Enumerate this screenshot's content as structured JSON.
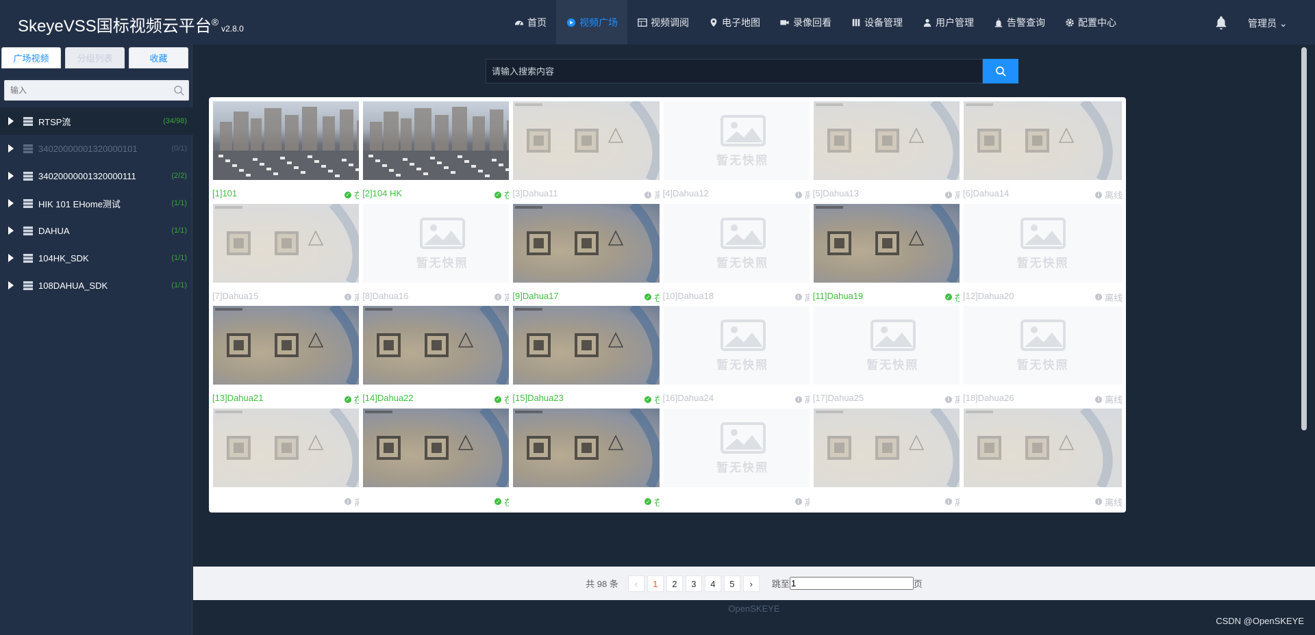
{
  "app": {
    "title": "SkeyeVSS国标视频云平台",
    "registered": "®",
    "version": "v2.8.0"
  },
  "nav": [
    {
      "label": "首页",
      "icon": "dashboard-icon"
    },
    {
      "label": "视频广场",
      "icon": "play-circle-icon",
      "active": true
    },
    {
      "label": "视频调阅",
      "icon": "grid-icon"
    },
    {
      "label": "电子地图",
      "icon": "map-pin-icon"
    },
    {
      "label": "录像回看",
      "icon": "video-camera-icon"
    },
    {
      "label": "设备管理",
      "icon": "server-icon"
    },
    {
      "label": "用户管理",
      "icon": "user-icon"
    },
    {
      "label": "告警查询",
      "icon": "alarm-icon"
    },
    {
      "label": "配置中心",
      "icon": "gear-icon"
    }
  ],
  "user": {
    "name": "管理员"
  },
  "sidebar": {
    "tabs": [
      "广场视频",
      "分组列表",
      "收藏"
    ],
    "search_placeholder": "输入",
    "tree": [
      {
        "label": "RTSP流",
        "count": "(34/98)",
        "online": true,
        "selected": true
      },
      {
        "label": "34020000001320000101",
        "count": "(0/1)",
        "online": false
      },
      {
        "label": "34020000001320000111",
        "count": "(2/2)",
        "online": true
      },
      {
        "label": "HIK 101 EHome测试",
        "count": "(1/1)",
        "online": true
      },
      {
        "label": "DAHUA",
        "count": "(1/1)",
        "online": true
      },
      {
        "label": "104HK_SDK",
        "count": "(1/1)",
        "online": true
      },
      {
        "label": "108DAHUA_SDK",
        "count": "(1/1)",
        "online": true
      }
    ]
  },
  "search": {
    "placeholder": "请输入搜索内容"
  },
  "no_snapshot_text": "暂无快照",
  "status_labels": {
    "online": "在线",
    "offline": "离线"
  },
  "cards": [
    {
      "name": "[1]101",
      "online": true,
      "thumb": "city"
    },
    {
      "name": "[2]104 HK",
      "online": true,
      "thumb": "city"
    },
    {
      "name": "[3]Dahua11",
      "online": false,
      "thumb": "fade"
    },
    {
      "name": "[4]Dahua12",
      "online": false,
      "thumb": "none"
    },
    {
      "name": "[5]Dahua13",
      "online": false,
      "thumb": "fade"
    },
    {
      "name": "[6]Dahua14",
      "online": false,
      "thumb": "fade"
    },
    {
      "name": "[7]Dahua15",
      "online": false,
      "thumb": "fade"
    },
    {
      "name": "[8]Dahua16",
      "online": false,
      "thumb": "none"
    },
    {
      "name": "[9]Dahua17",
      "online": true,
      "thumb": "lab"
    },
    {
      "name": "[10]Dahua18",
      "online": false,
      "thumb": "none"
    },
    {
      "name": "[11]Dahua19",
      "online": true,
      "thumb": "lab"
    },
    {
      "name": "[12]Dahua20",
      "online": false,
      "thumb": "none"
    },
    {
      "name": "[13]Dahua21",
      "online": true,
      "thumb": "lab"
    },
    {
      "name": "[14]Dahua22",
      "online": true,
      "thumb": "lab"
    },
    {
      "name": "[15]Dahua23",
      "online": true,
      "thumb": "lab"
    },
    {
      "name": "[16]Dahua24",
      "online": false,
      "thumb": "none"
    },
    {
      "name": "[17]Dahua25",
      "online": false,
      "thumb": "none"
    },
    {
      "name": "[18]Dahua26",
      "online": false,
      "thumb": "none"
    },
    {
      "name": "",
      "online": false,
      "thumb": "fade"
    },
    {
      "name": "",
      "online": true,
      "thumb": "lab"
    },
    {
      "name": "",
      "online": true,
      "thumb": "lab"
    },
    {
      "name": "",
      "online": false,
      "thumb": "none"
    },
    {
      "name": "",
      "online": false,
      "thumb": "fade"
    },
    {
      "name": "",
      "online": false,
      "thumb": "fade"
    }
  ],
  "pagination": {
    "total": "共 98 条",
    "pages": [
      "1",
      "2",
      "3",
      "4",
      "5"
    ],
    "current": "1",
    "jump_label": "跳至",
    "jump_value": "1",
    "page_suffix": "页"
  },
  "footer": {
    "text": "OpenSKEYE"
  },
  "watermark": "CSDN @OpenSKEYE",
  "colors": {
    "accent": "#1e90ff",
    "online": "#3fbf3f",
    "offline": "#c0c4cc",
    "header": "#223047",
    "content": "#1b2838"
  }
}
